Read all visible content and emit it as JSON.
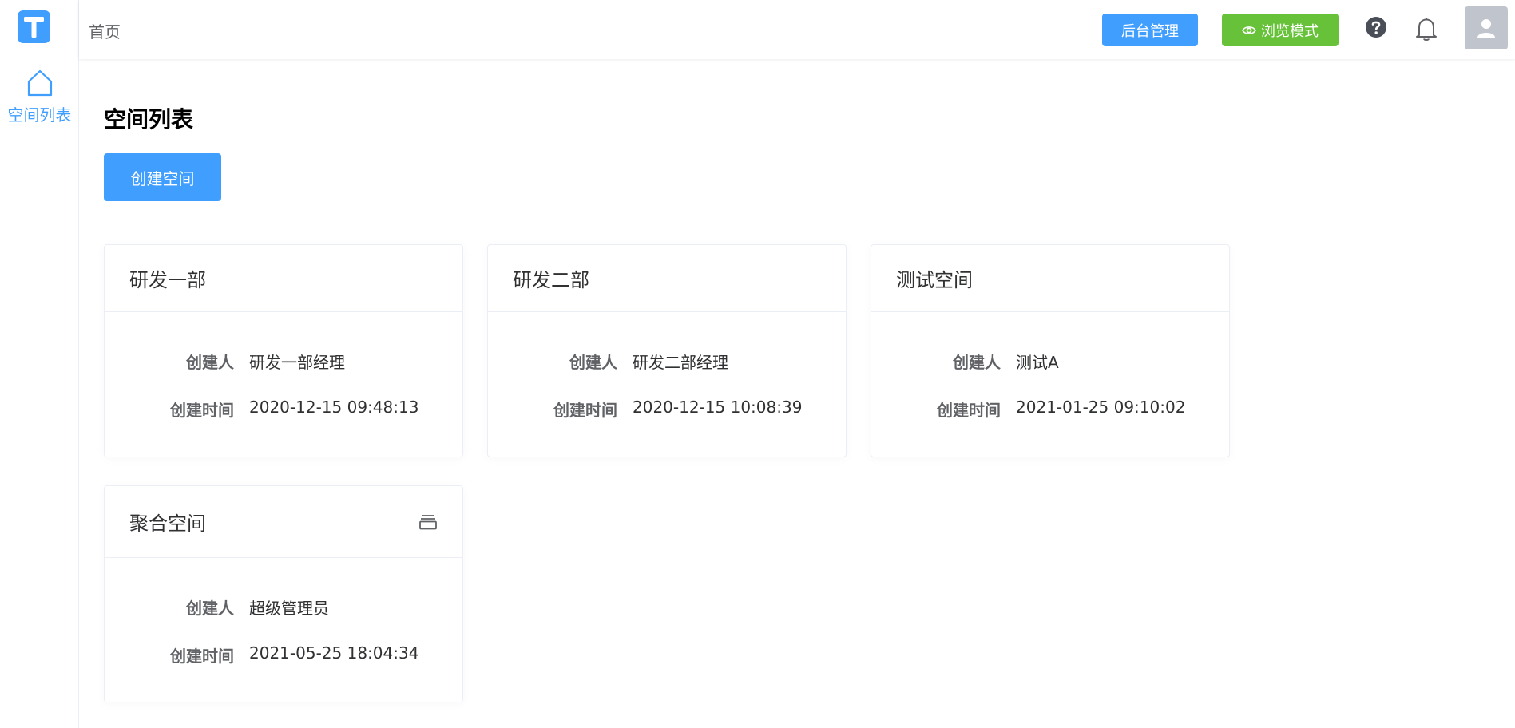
{
  "sidebar": {
    "logo_letter": "T",
    "items": [
      {
        "label": "空间列表",
        "icon": "home-icon",
        "active": true
      }
    ]
  },
  "header": {
    "breadcrumb": "首页",
    "admin_label": "后台管理",
    "browse_label": "浏览模式",
    "icons": [
      "eye-icon",
      "help-icon",
      "bell-icon",
      "user-avatar-icon"
    ]
  },
  "page": {
    "title": "空间列表",
    "create_label": "创建空间"
  },
  "fields": {
    "creator": "创建人",
    "created_at": "创建时间"
  },
  "cards": [
    {
      "name": "研发一部",
      "creator": "研发一部经理",
      "created_at": "2020-12-15 09:48:13"
    },
    {
      "name": "研发二部",
      "creator": "研发二部经理",
      "created_at": "2020-12-15 10:08:39"
    },
    {
      "name": "测试空间",
      "creator": "测试A",
      "created_at": "2021-01-25 09:10:02"
    },
    {
      "name": "聚合空间",
      "creator": "超级管理员",
      "created_at": "2021-05-25 18:04:34",
      "icon": "stack-icon"
    }
  ],
  "colors": {
    "primary": "#409eff",
    "success": "#67c23a",
    "avatar_bg": "#c0c4cc"
  }
}
